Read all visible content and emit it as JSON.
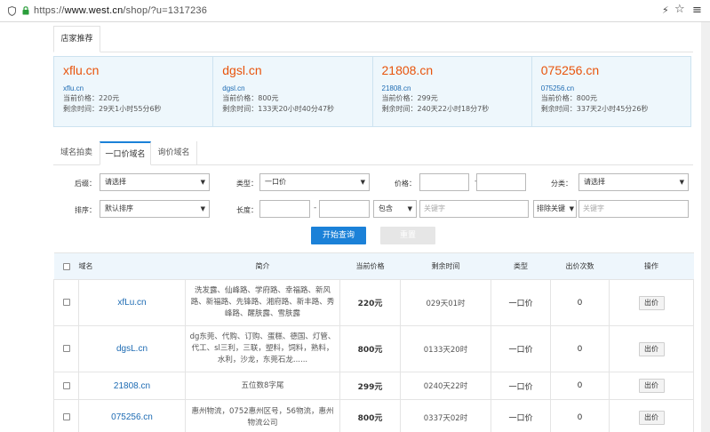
{
  "browser": {
    "url_scheme": "https://",
    "url_host": "www.west.cn",
    "url_path": "/shop/?u=1317236"
  },
  "recommend": {
    "tab_label": "店家推荐",
    "items": [
      {
        "domain": "xflu.cn",
        "link": "xflu.cn",
        "price": "当前价格：220元",
        "remaining": "剩余时间：29天1小时55分6秒"
      },
      {
        "domain": "dgsl.cn",
        "link": "dgsl.cn",
        "price": "当前价格：800元",
        "remaining": "剩余时间：133天20小时40分47秒"
      },
      {
        "domain": "21808.cn",
        "link": "21808.cn",
        "price": "当前价格：299元",
        "remaining": "剩余时间：240天22小时18分7秒"
      },
      {
        "domain": "075256.cn",
        "link": "075256.cn",
        "price": "当前价格：800元",
        "remaining": "剩余时间：337天2小时45分26秒"
      }
    ]
  },
  "tabs": [
    {
      "label": "域名拍卖",
      "active": false
    },
    {
      "label": "一口价域名",
      "active": true
    },
    {
      "label": "询价域名",
      "active": false
    }
  ],
  "filters": {
    "suffix_label": "后缀：",
    "suffix_value": "请选择",
    "type_label": "类型：",
    "type_value": "一口价",
    "price_label": "价格：",
    "category_label": "分类：",
    "category_value": "请选择",
    "sort_label": "排序：",
    "sort_value": "默认排序",
    "length_label": "长度：",
    "include_value": "包含",
    "keyword_placeholder": "关键字",
    "exclude_value": "排除关键",
    "exclude_placeholder": "关键字",
    "dash": "-"
  },
  "buttons": {
    "search": "开始查询",
    "reset": "重置"
  },
  "table": {
    "headers": [
      "域名",
      "简介",
      "当前价格",
      "剩余时间",
      "类型",
      "出价次数",
      "操作"
    ],
    "rows": [
      {
        "domain": "xfLu.cn",
        "desc": "洗发露、仙峰路、学府路、幸福路、新风路、新福路、先锋路、湘府路、新丰路、秀峰路、醒肤露、雪肤露",
        "price": "220元",
        "time": "029天01时",
        "type": "一口价",
        "bids": "0",
        "action": "出价"
      },
      {
        "domain": "dgsL.cn",
        "desc": "dg东莞、代购、订购、蛋糕、德国、灯管、代工、sl三利，三联，塑料，饲料，熟料，水利，沙龙，东莞石龙......",
        "price": "800元",
        "time": "0133天20时",
        "type": "一口价",
        "bids": "0",
        "action": "出价"
      },
      {
        "domain": "21808.cn",
        "desc": "五位数8字尾",
        "price": "299元",
        "time": "0240天22时",
        "type": "一口价",
        "bids": "0",
        "action": "出价"
      },
      {
        "domain": "075256.cn",
        "desc": "惠州物流，0752惠州区号，56物流，惠州物流公司",
        "price": "800元",
        "time": "0337天02时",
        "type": "一口价",
        "bids": "0",
        "action": "出价"
      }
    ]
  }
}
